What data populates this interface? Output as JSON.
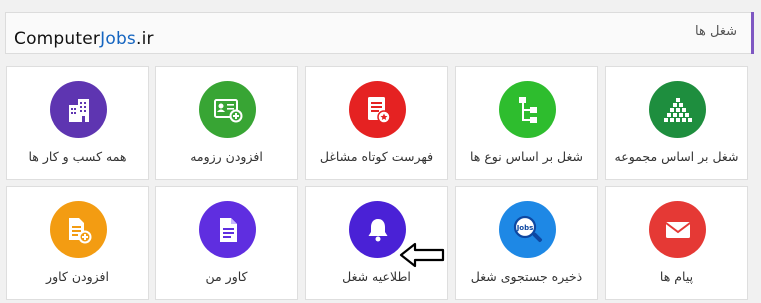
{
  "brand": {
    "part1": "Computer",
    "part2": "Jobs",
    "part3": ".ir"
  },
  "header": {
    "title": "شغل ها"
  },
  "tiles": [
    {
      "label": "شغل بر اساس مجموعه",
      "icon": "pyramid-grid-icon",
      "color": "#1e8e3e"
    },
    {
      "label": "شغل بر اساس نوع ها",
      "icon": "hierarchy-icon",
      "color": "#2ebd2e"
    },
    {
      "label": "فهرست کوتاه مشاغل",
      "icon": "shortlist-icon",
      "color": "#e52222"
    },
    {
      "label": "افزودن رزومه",
      "icon": "add-resume-icon",
      "color": "#38a534"
    },
    {
      "label": "همه کسب و کار ها",
      "icon": "buildings-icon",
      "color": "#5e35b1"
    },
    {
      "label": "پیام ها",
      "icon": "mail-icon",
      "color": "#e53935"
    },
    {
      "label": "ذخیره جستجوی شغل",
      "icon": "jobs-search-icon",
      "color": "#1e88e5"
    },
    {
      "label": "اطلاعیه شغل",
      "icon": "bell-icon",
      "color": "#4a21d6"
    },
    {
      "label": "کاور من",
      "icon": "document-icon",
      "color": "#5f2ee0"
    },
    {
      "label": "افزودن کاور",
      "icon": "add-cover-icon",
      "color": "#f39c12"
    }
  ]
}
